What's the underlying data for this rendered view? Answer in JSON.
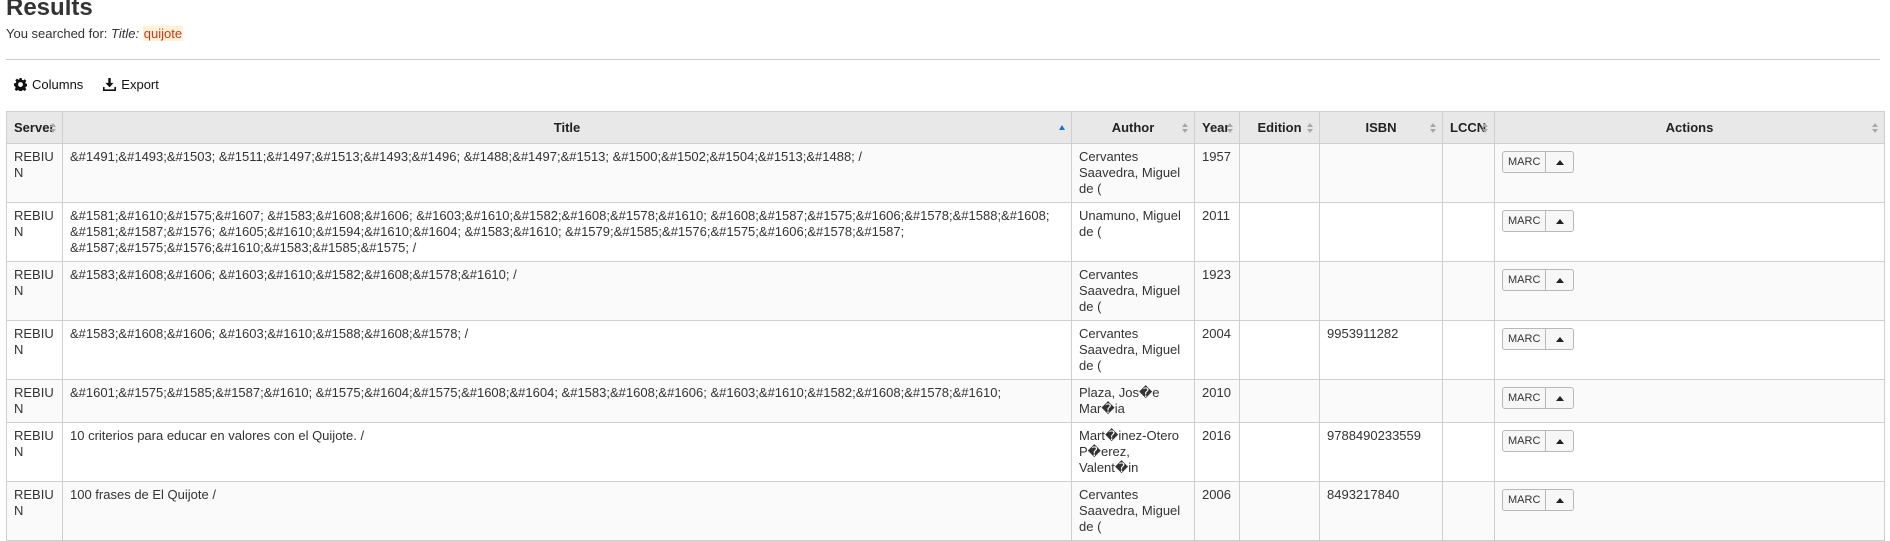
{
  "page": {
    "title": "Results",
    "searched_prefix": "You searched for: ",
    "searched_label": "Title:",
    "searched_term": "quijote"
  },
  "toolbar": {
    "columns_label": "Columns",
    "export_label": "Export"
  },
  "table": {
    "headers": {
      "server": "Server",
      "title": "Title",
      "author": "Author",
      "year": "Year",
      "edition": "Edition",
      "isbn": "ISBN",
      "lccn": "LCCN",
      "actions": "Actions"
    },
    "marc_label": "MARC",
    "rows": [
      {
        "server": "REBIUN",
        "title": "&#1491;&#1493;&#1503; &#1511;&#1497;&#1513;&#1493;&#1496; &#1488;&#1497;&#1513; &#1500;&#1502;&#1504;&#1513;&#1488; /",
        "author": "Cervantes Saavedra, Miguel de (",
        "year": "1957",
        "edition": "",
        "isbn": "",
        "lccn": ""
      },
      {
        "server": "REBIUN",
        "title": "&#1581;&#1610;&#1575;&#1607; &#1583;&#1608;&#1606; &#1603;&#1610;&#1582;&#1608;&#1578;&#1610; &#1608;&#1587;&#1575;&#1606;&#1578;&#1588;&#1608; &#1581;&#1587;&#1576; &#1605;&#1610;&#1594;&#1610;&#1604; &#1583;&#1610; &#1579;&#1585;&#1576;&#1575;&#1606;&#1578;&#1587; &#1587;&#1575;&#1576;&#1610;&#1583;&#1585;&#1575; /",
        "author": "Unamuno, Miguel de (",
        "year": "2011",
        "edition": "",
        "isbn": "",
        "lccn": ""
      },
      {
        "server": "REBIUN",
        "title": "&#1583;&#1608;&#1606; &#1603;&#1610;&#1582;&#1608;&#1578;&#1610; /",
        "author": "Cervantes Saavedra, Miguel de (",
        "year": "1923",
        "edition": "",
        "isbn": "",
        "lccn": ""
      },
      {
        "server": "REBIUN",
        "title": "&#1583;&#1608;&#1606; &#1603;&#1610;&#1588;&#1608;&#1578; /",
        "author": "Cervantes Saavedra, Miguel de (",
        "year": "2004",
        "edition": "",
        "isbn": "9953911282",
        "lccn": ""
      },
      {
        "server": "REBIUN",
        "title": "&#1601;&#1575;&#1585;&#1587;&#1610; &#1575;&#1604;&#1575;&#1608;&#1604; &#1583;&#1608;&#1606; &#1603;&#1610;&#1582;&#1608;&#1578;&#1610;",
        "author": "Plaza, Jos�e Mar�ia",
        "year": "2010",
        "edition": "",
        "isbn": "",
        "lccn": ""
      },
      {
        "server": "REBIUN",
        "title": "10 criterios para educar en valores con el Quijote. /",
        "author": "Mart�inez-Otero P�erez, Valent�in",
        "year": "2016",
        "edition": "",
        "isbn": "9788490233559",
        "lccn": ""
      },
      {
        "server": "REBIUN",
        "title": "100 frases de El Quijote /",
        "author": "Cervantes Saavedra, Miguel de (",
        "year": "2006",
        "edition": "",
        "isbn": "8493217840",
        "lccn": ""
      }
    ]
  },
  "icons": {
    "columns": "gear-icon",
    "export": "download-icon",
    "sort_both": "sort-icon",
    "sort_up": "sort-ascending-icon",
    "caret": "caret-up-icon"
  },
  "colors": {
    "header_bg": "#e8e8e8",
    "sort_active": "#1f6fd0",
    "highlight_bg": "#fff3d4",
    "highlight_text": "#c0392b"
  }
}
